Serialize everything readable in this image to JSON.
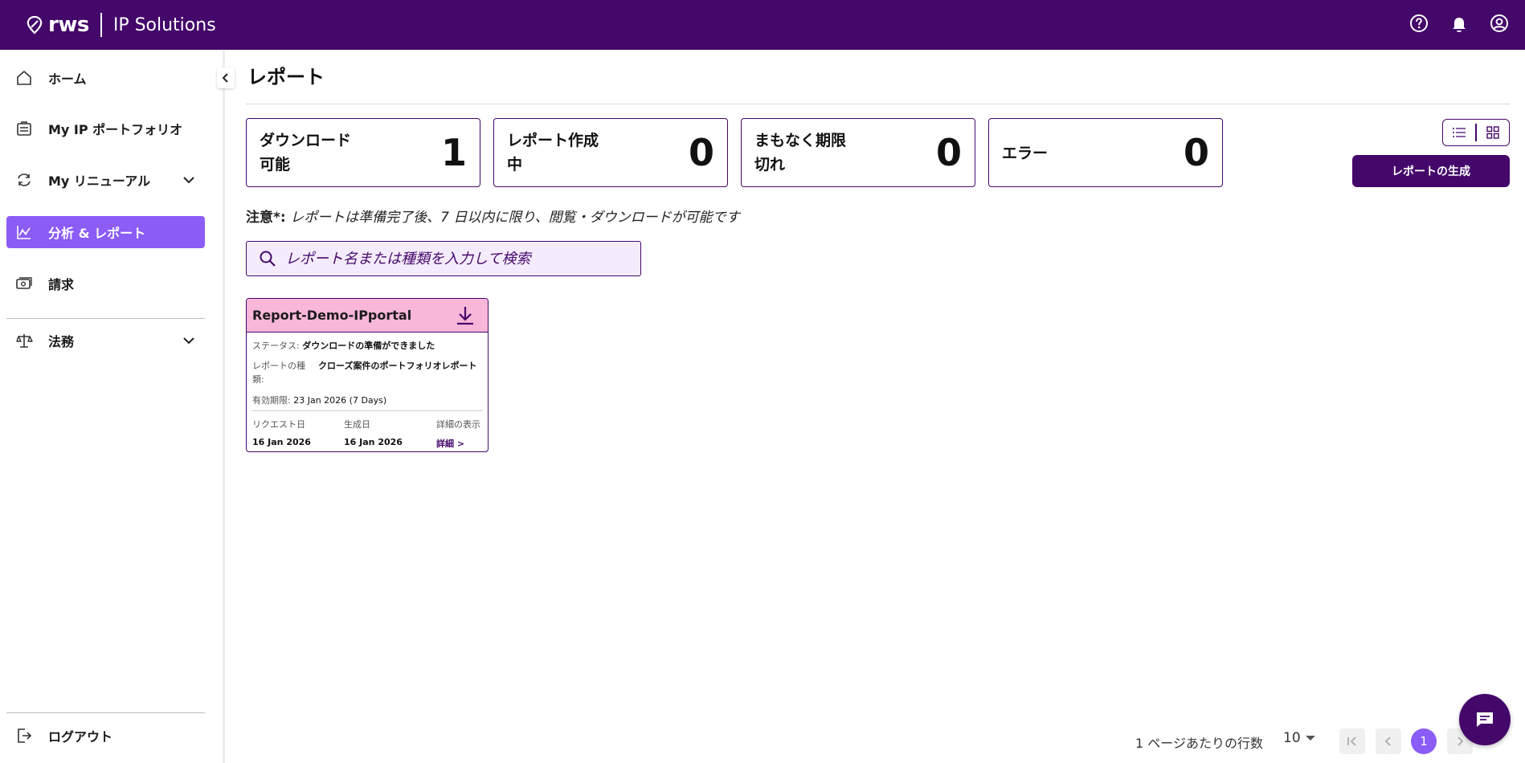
{
  "header": {
    "brand": "rws",
    "product": "IP Solutions",
    "icons": [
      "help-icon",
      "bell-icon",
      "account-icon"
    ]
  },
  "sidebar": {
    "items": [
      {
        "label": "ホーム",
        "icon": "home-icon"
      },
      {
        "label": "My IP ポートフォリオ",
        "icon": "portfolio-icon"
      },
      {
        "label": "My リニューアル",
        "icon": "renewal-icon",
        "expandable": true
      },
      {
        "label": "分析 & レポート",
        "icon": "analytics-icon",
        "active": true
      },
      {
        "label": "請求",
        "icon": "billing-icon"
      },
      {
        "label": "法務",
        "icon": "scales-icon",
        "expandable": true
      }
    ],
    "logout": "ログアウト"
  },
  "page": {
    "title": "レポート"
  },
  "stats": [
    {
      "label": "ダウンロード可能",
      "value": "1"
    },
    {
      "label": "レポート作成中",
      "value": "0"
    },
    {
      "label": "まもなく期限切れ",
      "value": "0"
    },
    {
      "label": "エラー",
      "value": "0"
    }
  ],
  "actions": {
    "generate": "レポートの生成"
  },
  "note": {
    "prefix": "注意*:",
    "text": " レポートは準備完了後、7 日以内に限り、閲覧・ダウンロードが可能です"
  },
  "search": {
    "placeholder": "レポート名または種類を入力して検索",
    "value": ""
  },
  "report": {
    "title": "Report-Demo-IPportal",
    "status_key": "ステータス:",
    "status_value": "ダウンロードの準備ができました",
    "type_key": "レポートの種類:",
    "type_value": "クローズ案件のポートフォリオレポート",
    "expiry_key": "有効期限:",
    "expiry_value": "23 Jan 2026 (7 Days)",
    "requested_key": "リクエスト日",
    "requested_value": "16 Jan 2026",
    "generated_key": "生成日",
    "generated_value": "16 Jan 2026",
    "details_key": "詳細の表示",
    "details_link": "詳細 >"
  },
  "pagination": {
    "rows_label": "1 ページあたりの行数",
    "rows_value": "10",
    "current_page": "1"
  },
  "colors": {
    "brand": "#44076a",
    "accent": "#8b5cf6",
    "card_header": "#f8b6d9",
    "search_bg": "#f4ecfc"
  }
}
